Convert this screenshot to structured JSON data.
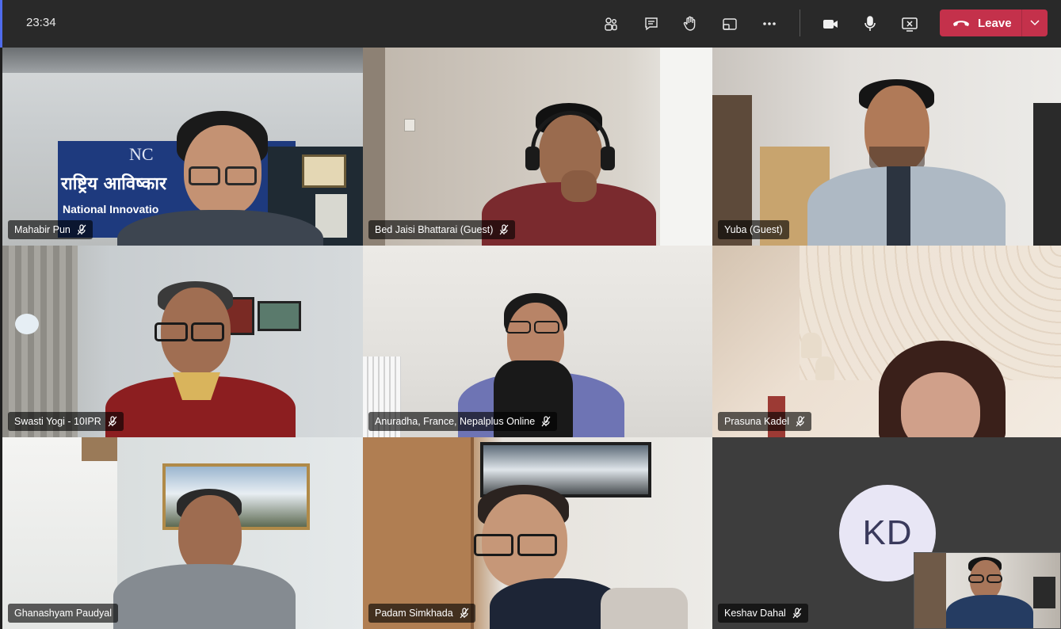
{
  "toolbar": {
    "timer": "23:34",
    "icons": [
      "participants-icon",
      "chat-icon",
      "raise-hand-icon",
      "share-tray-icon",
      "more-options-icon",
      "camera-icon",
      "microphone-icon",
      "stop-share-icon"
    ],
    "leave_label": "Leave",
    "leave_color": "#c4314b"
  },
  "participants": [
    {
      "name": "Mahabir Pun",
      "muted": true,
      "sign_text_1": "राष्ट्रिय आविष्कार",
      "sign_text_2": "National Innovatio",
      "sign_logo": "NC"
    },
    {
      "name": "Bed Jaisi Bhattarai (Guest)",
      "muted": true
    },
    {
      "name": "Yuba (Guest)",
      "muted": false
    },
    {
      "name": "Swasti Yogi - 10IPR",
      "muted": true
    },
    {
      "name": "Anuradha, France, Nepalplus Online",
      "muted": true
    },
    {
      "name": "Prasuna Kadel",
      "muted": true
    },
    {
      "name": "Ghanashyam Paudyal",
      "muted": false
    },
    {
      "name": "Padam Simkhada",
      "muted": true
    },
    {
      "name": "Keshav Dahal",
      "muted": true,
      "initials": "KD"
    }
  ],
  "self_view": {
    "label": ""
  }
}
